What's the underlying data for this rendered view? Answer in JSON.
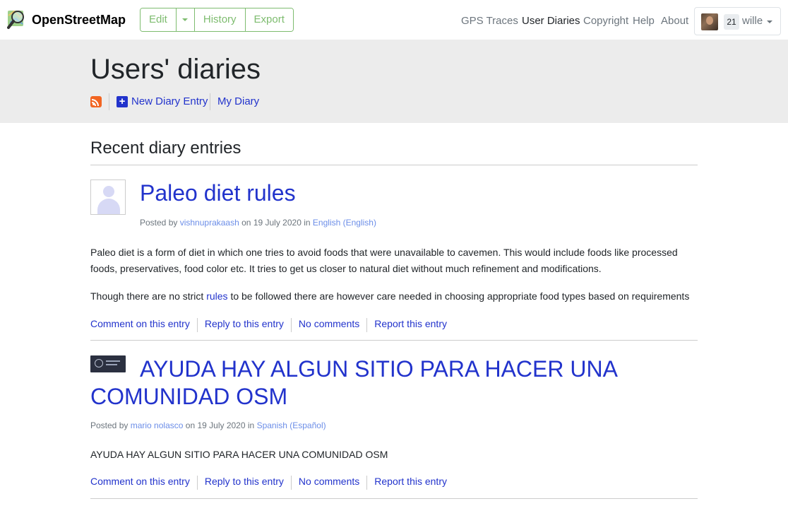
{
  "header": {
    "brand": "OpenStreetMap",
    "edit_label": "Edit",
    "history_label": "History",
    "export_label": "Export",
    "nav": [
      "GPS Traces",
      "User Diaries",
      "Copyright",
      "Help",
      "About"
    ],
    "active_nav": "User Diaries",
    "user": {
      "count": "21",
      "name": "wille"
    }
  },
  "band": {
    "title": "Users' diaries",
    "new_entry_label": "New Diary Entry",
    "my_diary_label": "My Diary"
  },
  "main": {
    "section_title": "Recent diary entries",
    "entries": [
      {
        "title": "Paleo diet rules",
        "posted_by_label": "Posted by",
        "author": "vishnuprakaash",
        "on_label": "on",
        "date": "19 July 2020",
        "in_label": "in",
        "language": "English (English)",
        "paragraphs": [
          "Paleo diet is a form of diet in which one tries to avoid foods that were unavailable to cavemen. This would include foods like processed foods, preservatives, food color etc. It tries to get us closer to natural diet without much refinement and modifications."
        ],
        "para2_before": "Though there are no strict ",
        "para2_link": "rules",
        "para2_after": " to be followed there are however care needed in choosing appropriate food types based on requirements",
        "actions": [
          "Comment on this entry",
          "Reply to this entry",
          "No comments",
          "Report this entry"
        ]
      },
      {
        "title": "AYUDA HAY ALGUN SITIO PARA HACER UNA COMUNIDAD OSM",
        "posted_by_label": "Posted by",
        "author": "mario nolasco",
        "on_label": "on",
        "date": "19 July 2020",
        "in_label": "in",
        "language": "Spanish (Español)",
        "paragraphs": [
          "AYUDA HAY ALGUN SITIO PARA HACER UNA COMUNIDAD OSM"
        ],
        "actions": [
          "Comment on this entry",
          "Reply to this entry",
          "No comments",
          "Report this entry"
        ]
      }
    ]
  },
  "icons": {
    "logo": "osm-magnifier-logo-icon",
    "rss": "rss-icon",
    "new_entry": "plus-icon",
    "default_avatar": "default-user-avatar-icon"
  },
  "colors": {
    "accent_green": "#7ebc6f",
    "link_blue": "#2233cc",
    "band_gray": "#ececec",
    "rss_orange": "#f26522"
  }
}
